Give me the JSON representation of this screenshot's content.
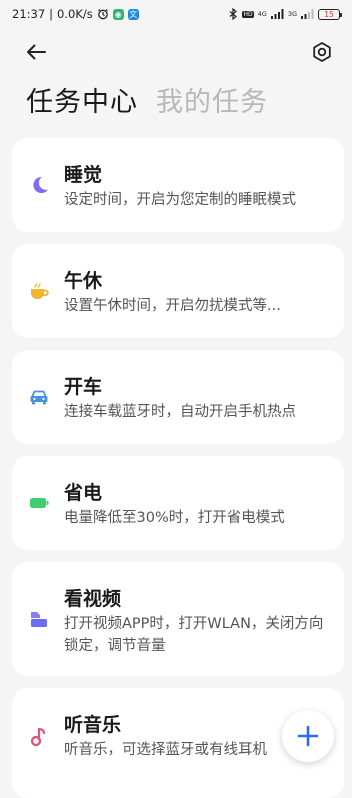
{
  "status_bar": {
    "time": "21:37",
    "net_speed": "0.0K/s",
    "signal1": "4G",
    "signal2": "3G",
    "battery": "15"
  },
  "header": {
    "tabs": [
      {
        "label": "任务中心",
        "active": true
      },
      {
        "label": "我的任务",
        "active": false
      }
    ]
  },
  "tasks": [
    {
      "title": "睡觉",
      "desc": "设定时间，开启为您定制的睡眠模式",
      "icon": "moon-icon",
      "color": "#7b6cf0"
    },
    {
      "title": "午休",
      "desc": "设置午休时间，开启勿扰模式等...",
      "icon": "tea-cup-icon",
      "color": "#f1b62c"
    },
    {
      "title": "开车",
      "desc": "连接车载蓝牙时，自动开启手机热点",
      "icon": "car-icon",
      "color": "#4a90e2"
    },
    {
      "title": "省电",
      "desc": "电量降低至30%时，打开省电模式",
      "icon": "battery-icon",
      "color": "#3fcf6a"
    },
    {
      "title": "看视频",
      "desc": "打开视频APP时，打开WLAN，关闭方向锁定，调节音量",
      "icon": "video-icon",
      "color": "#6b6cf0"
    },
    {
      "title": "听音乐",
      "desc": "听音乐，可选择蓝牙或有线耳机",
      "icon": "music-note-icon",
      "color": "#e0557a"
    }
  ],
  "colors": {
    "accent": "#2f6cf0",
    "background": "#f5f5f5"
  }
}
